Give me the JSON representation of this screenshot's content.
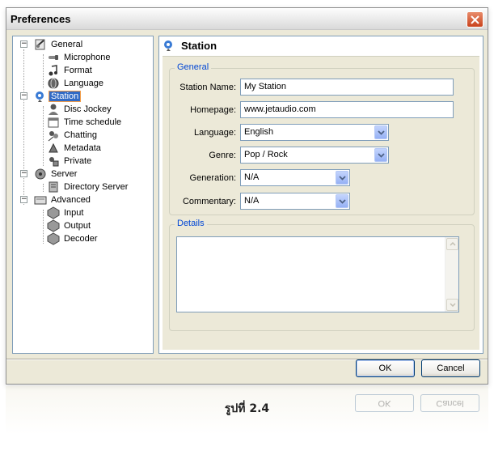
{
  "window": {
    "title": "Preferences"
  },
  "tree": {
    "items": [
      {
        "label": "General",
        "icon": "gear-wrench-icon"
      },
      {
        "label": "Microphone",
        "icon": "microphone-icon"
      },
      {
        "label": "Format",
        "icon": "music-note-icon"
      },
      {
        "label": "Language",
        "icon": "globe-icon"
      },
      {
        "label": "Station",
        "icon": "satellite-dish-icon",
        "selected": true
      },
      {
        "label": "Disc Jockey",
        "icon": "user-icon"
      },
      {
        "label": "Time schedule",
        "icon": "calendar-icon"
      },
      {
        "label": "Chatting",
        "icon": "chat-icon"
      },
      {
        "label": "Metadata",
        "icon": "metadata-icon"
      },
      {
        "label": "Private",
        "icon": "private-icon"
      },
      {
        "label": "Server",
        "icon": "server-icon"
      },
      {
        "label": "Directory Server",
        "icon": "directory-server-icon"
      },
      {
        "label": "Advanced",
        "icon": "advanced-icon"
      },
      {
        "label": "Input",
        "icon": "input-icon"
      },
      {
        "label": "Output",
        "icon": "output-icon"
      },
      {
        "label": "Decoder",
        "icon": "decoder-icon"
      }
    ]
  },
  "content": {
    "title": "Station",
    "general_group": {
      "legend": "General",
      "station_name": {
        "label": "Station Name:",
        "value": "My Station"
      },
      "homepage": {
        "label": "Homepage:",
        "value": "www.jetaudio.com"
      },
      "language": {
        "label": "Language:",
        "value": "English"
      },
      "genre": {
        "label": "Genre:",
        "value": "Pop / Rock"
      },
      "generation": {
        "label": "Generation:",
        "value": "N/A"
      },
      "commentary": {
        "label": "Commentary:",
        "value": "N/A"
      }
    },
    "details_group": {
      "legend": "Details"
    }
  },
  "buttons": {
    "ok": "OK",
    "cancel": "Cancel"
  },
  "caption": "รูปที่ 2.4",
  "colors": {
    "accent": "#316ac5",
    "legend": "#0046d5",
    "close": "#c9421c"
  }
}
